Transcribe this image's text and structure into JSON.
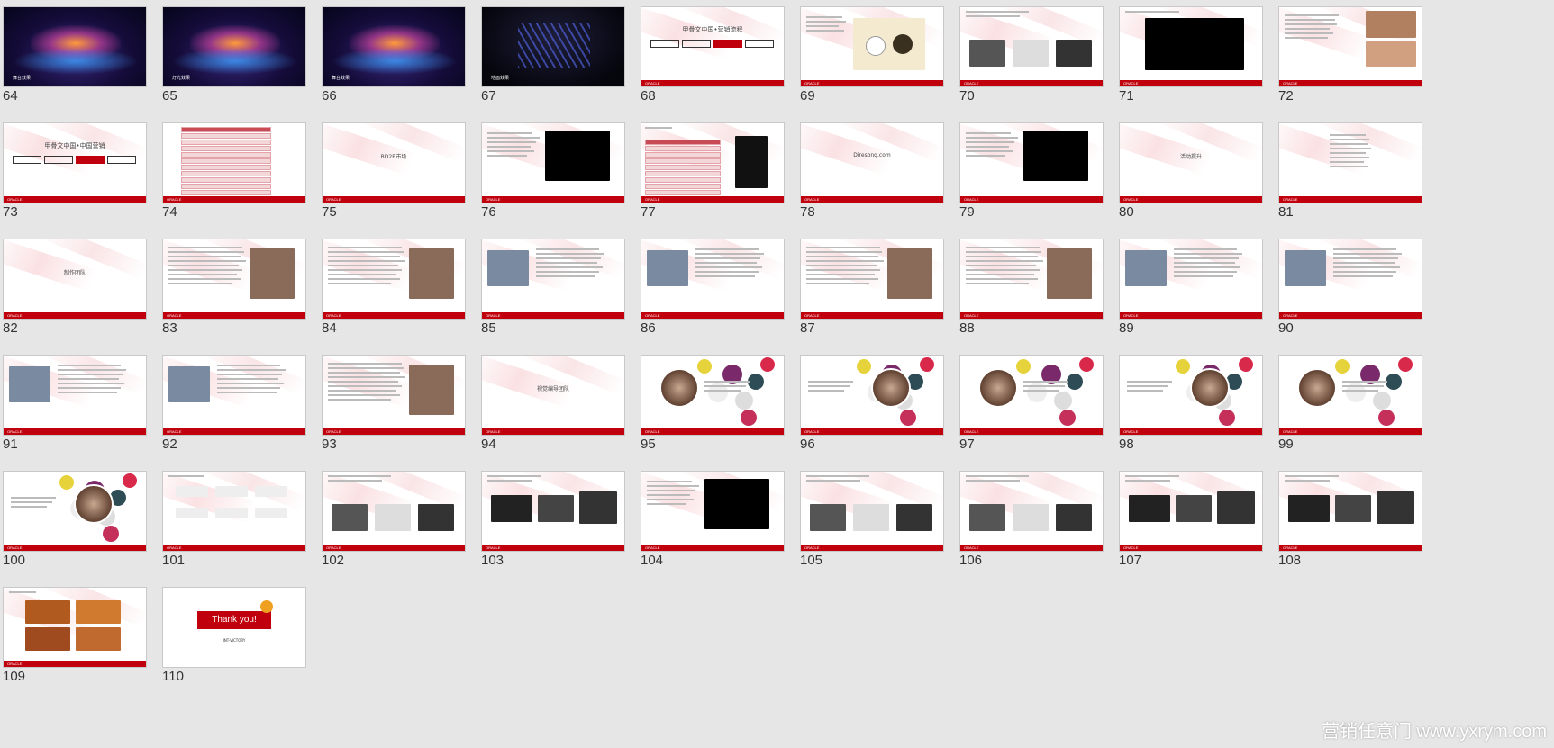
{
  "slides": [
    {
      "n": "64",
      "kind": "stage",
      "caption": "舞台效果"
    },
    {
      "n": "65",
      "kind": "stage",
      "caption": "灯光效果"
    },
    {
      "n": "66",
      "kind": "stage",
      "caption": "舞台效果"
    },
    {
      "n": "67",
      "kind": "dark",
      "caption": "地面效果"
    },
    {
      "n": "68",
      "kind": "title-buttons",
      "title": "甲骨文中国•营销流程"
    },
    {
      "n": "69",
      "kind": "content",
      "variant": "badges"
    },
    {
      "n": "70",
      "kind": "content",
      "variant": "three-images"
    },
    {
      "n": "71",
      "kind": "video"
    },
    {
      "n": "72",
      "kind": "content",
      "variant": "list-photo"
    },
    {
      "n": "73",
      "kind": "title-buttons",
      "title": "甲骨文中国•中国营销"
    },
    {
      "n": "74",
      "kind": "table"
    },
    {
      "n": "75",
      "kind": "section",
      "title": "BD2B市场"
    },
    {
      "n": "76",
      "kind": "text-video"
    },
    {
      "n": "77",
      "kind": "content",
      "variant": "table-badge"
    },
    {
      "n": "78",
      "kind": "section",
      "title": "Diresong.com"
    },
    {
      "n": "79",
      "kind": "text-video"
    },
    {
      "n": "80",
      "kind": "section",
      "title": "活动提升"
    },
    {
      "n": "81",
      "kind": "content",
      "variant": "bullets"
    },
    {
      "n": "82",
      "kind": "section",
      "title": "制作团队"
    },
    {
      "n": "83",
      "kind": "content",
      "variant": "text-photo"
    },
    {
      "n": "84",
      "kind": "content",
      "variant": "text-photo"
    },
    {
      "n": "85",
      "kind": "content",
      "variant": "photos-left"
    },
    {
      "n": "86",
      "kind": "content",
      "variant": "photos-left"
    },
    {
      "n": "87",
      "kind": "content",
      "variant": "text-photo"
    },
    {
      "n": "88",
      "kind": "content",
      "variant": "text-photo"
    },
    {
      "n": "89",
      "kind": "content",
      "variant": "photos-left"
    },
    {
      "n": "90",
      "kind": "content",
      "variant": "photos-left"
    },
    {
      "n": "91",
      "kind": "content",
      "variant": "photos-left"
    },
    {
      "n": "92",
      "kind": "content",
      "variant": "photos-left"
    },
    {
      "n": "93",
      "kind": "content",
      "variant": "text-photo"
    },
    {
      "n": "94",
      "kind": "section",
      "title": "视觉编导团队"
    },
    {
      "n": "95",
      "kind": "circles"
    },
    {
      "n": "96",
      "kind": "circles"
    },
    {
      "n": "97",
      "kind": "circles"
    },
    {
      "n": "98",
      "kind": "circles"
    },
    {
      "n": "99",
      "kind": "circles"
    },
    {
      "n": "100",
      "kind": "circles"
    },
    {
      "n": "101",
      "kind": "content",
      "variant": "flowchart"
    },
    {
      "n": "102",
      "kind": "content",
      "variant": "three-images"
    },
    {
      "n": "103",
      "kind": "content",
      "variant": "equipment"
    },
    {
      "n": "104",
      "kind": "text-video"
    },
    {
      "n": "105",
      "kind": "content",
      "variant": "three-images"
    },
    {
      "n": "106",
      "kind": "content",
      "variant": "three-images"
    },
    {
      "n": "107",
      "kind": "content",
      "variant": "equipment"
    },
    {
      "n": "108",
      "kind": "content",
      "variant": "equipment"
    },
    {
      "n": "109",
      "kind": "content",
      "variant": "photo-grid"
    },
    {
      "n": "110",
      "kind": "thankyou",
      "title": "Thank you!",
      "brand": "INT-VICTORY",
      "dot": "new"
    }
  ],
  "footer_logo": "ORACLE",
  "watermark": "营销任意门 www.yxrym.com",
  "colors": {
    "accent": "#c0000c",
    "background": "#e6e6e6"
  }
}
